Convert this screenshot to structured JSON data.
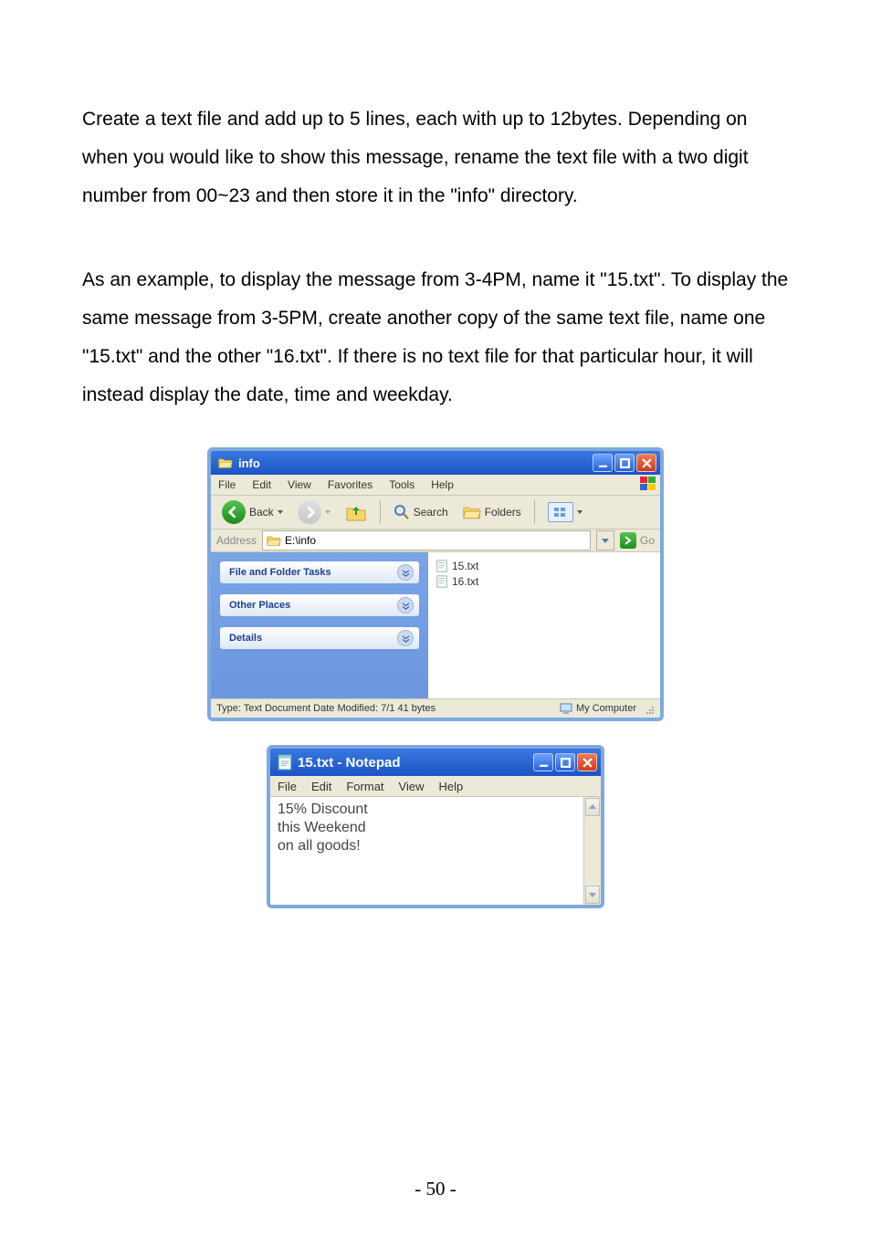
{
  "body": {
    "p1": "Create a text file and add up to 5 lines, each with up to 12bytes. Depending on when you would like to show this message, rename the text file with a two digit number from 00~23 and then store it in the \"info\" directory.",
    "p2": "As an example, to display the message from 3-4PM, name it \"15.txt\". To display the same message from 3-5PM, create another copy of the same text file, name one \"15.txt\" and the other \"16.txt\". If there is no text file for that particular hour, it will instead display the date, time and weekday."
  },
  "explorer": {
    "title": "info",
    "menu": {
      "file": "File",
      "edit": "Edit",
      "view": "View",
      "favorites": "Favorites",
      "tools": "Tools",
      "help": "Help"
    },
    "toolbar": {
      "back": "Back",
      "search": "Search",
      "folders": "Folders"
    },
    "address": {
      "label": "Address",
      "path": "E:\\info",
      "go": "Go"
    },
    "tasks": {
      "t1": "File and Folder Tasks",
      "t2": "Other Places",
      "t3": "Details"
    },
    "files": [
      "15.txt",
      "16.txt"
    ],
    "status": {
      "left": "Type: Text Document Date Modified: 7/1 41 bytes",
      "right": "My Computer"
    }
  },
  "notepad": {
    "title": "15.txt - Notepad",
    "menu": {
      "file": "File",
      "edit": "Edit",
      "format": "Format",
      "view": "View",
      "help": "Help"
    },
    "content": "15% Discount\nthis Weekend\non all goods!"
  },
  "page_number": "- 50 -"
}
